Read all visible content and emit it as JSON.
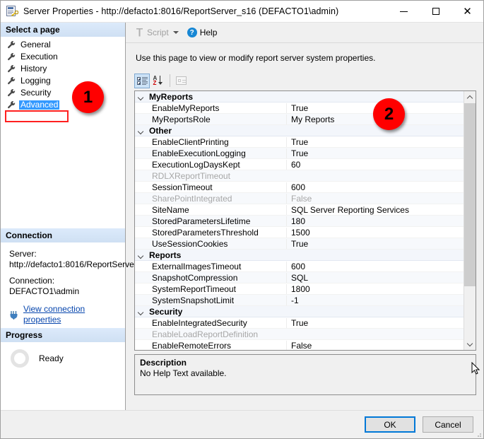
{
  "window": {
    "title": "Server Properties - http://defacto1:8016/ReportServer_s16 (DEFACTO1\\admin)",
    "icon": "server-properties-icon",
    "minimize_label": "Minimize",
    "maximize_label": "Maximize",
    "close_label": "Close"
  },
  "sidebar": {
    "header": "Select a page",
    "items": [
      {
        "label": "General",
        "icon": "wrench-icon",
        "selected": false
      },
      {
        "label": "Execution",
        "icon": "wrench-icon",
        "selected": false
      },
      {
        "label": "History",
        "icon": "wrench-icon",
        "selected": false
      },
      {
        "label": "Logging",
        "icon": "wrench-icon",
        "selected": false
      },
      {
        "label": "Security",
        "icon": "wrench-icon",
        "selected": false
      },
      {
        "label": "Advanced",
        "icon": "wrench-icon",
        "selected": true
      }
    ],
    "connection": {
      "header": "Connection",
      "server_label": "Server:",
      "server_value": "http://defacto1:8016/ReportServe",
      "connection_label": "Connection:",
      "connection_value": "DEFACTO1\\admin",
      "link": "View connection properties",
      "link_icon": "connection-properties-icon"
    },
    "progress": {
      "header": "Progress",
      "status": "Ready",
      "icon": "progress-spinner-icon"
    }
  },
  "toolbar": {
    "script_label": "Script",
    "script_icon": "script-icon",
    "script_dropdown_icon": "chevron-down-icon",
    "help_label": "Help",
    "help_icon": "help-icon"
  },
  "main": {
    "intro": "Use this page to view or modify report server system properties.",
    "grid_toolbar": [
      {
        "name": "categorized-button",
        "icon": "categorized-icon",
        "pressed": true,
        "disabled": false
      },
      {
        "name": "alphabetical-sort-button",
        "icon": "sort-az-icon",
        "pressed": false,
        "disabled": false
      },
      {
        "name": "property-pages-button",
        "icon": "property-pages-icon",
        "pressed": false,
        "disabled": true
      }
    ],
    "property_grid": {
      "categories": [
        {
          "name": "MyReports",
          "expanded": true,
          "properties": [
            {
              "name": "EnableMyReports",
              "value": "True",
              "disabled": false
            },
            {
              "name": "MyReportsRole",
              "value": "My Reports",
              "disabled": false
            }
          ]
        },
        {
          "name": "Other",
          "expanded": true,
          "properties": [
            {
              "name": "EnableClientPrinting",
              "value": "True",
              "disabled": false
            },
            {
              "name": "EnableExecutionLogging",
              "value": "True",
              "disabled": false
            },
            {
              "name": "ExecutionLogDaysKept",
              "value": "60",
              "disabled": false
            },
            {
              "name": "RDLXReportTimeout",
              "value": "",
              "disabled": true
            },
            {
              "name": "SessionTimeout",
              "value": "600",
              "disabled": false
            },
            {
              "name": "SharePointIntegrated",
              "value": "False",
              "disabled": true
            },
            {
              "name": "SiteName",
              "value": "SQL Server Reporting Services",
              "disabled": false
            },
            {
              "name": "StoredParametersLifetime",
              "value": "180",
              "disabled": false
            },
            {
              "name": "StoredParametersThreshold",
              "value": "1500",
              "disabled": false
            },
            {
              "name": "UseSessionCookies",
              "value": "True",
              "disabled": false
            }
          ]
        },
        {
          "name": "Reports",
          "expanded": true,
          "properties": [
            {
              "name": "ExternalImagesTimeout",
              "value": "600",
              "disabled": false
            },
            {
              "name": "SnapshotCompression",
              "value": "SQL",
              "disabled": false
            },
            {
              "name": "SystemReportTimeout",
              "value": "1800",
              "disabled": false
            },
            {
              "name": "SystemSnapshotLimit",
              "value": "-1",
              "disabled": false
            }
          ]
        },
        {
          "name": "Security",
          "expanded": true,
          "properties": [
            {
              "name": "EnableIntegratedSecurity",
              "value": "True",
              "disabled": false
            },
            {
              "name": "EnableLoadReportDefinition",
              "value": "",
              "disabled": true
            },
            {
              "name": "EnableRemoteErrors",
              "value": "False",
              "disabled": false
            }
          ]
        }
      ]
    },
    "description": {
      "title": "Description",
      "text": "No Help Text available."
    }
  },
  "footer": {
    "ok_label": "OK",
    "cancel_label": "Cancel"
  },
  "annotations": [
    {
      "id": "1",
      "label": "1"
    },
    {
      "id": "2",
      "label": "2"
    }
  ],
  "colors": {
    "annotation_red": "#ff0000",
    "selection_blue": "#3399ff",
    "focus_blue": "#0078d7",
    "link_blue": "#0645ad",
    "pane_header": "#d6e5f5"
  }
}
